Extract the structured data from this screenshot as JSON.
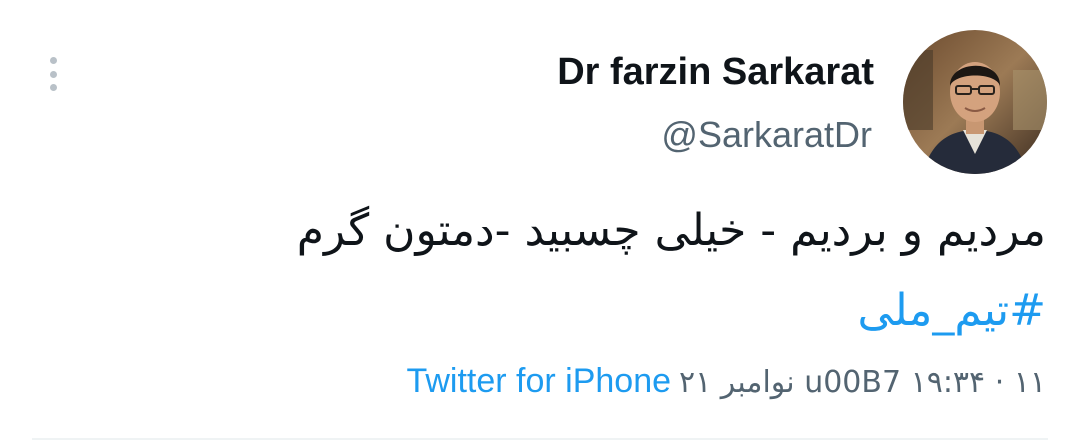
{
  "tweet": {
    "author": {
      "display_name": "Dr farzin Sarkarat",
      "handle": "@SarkaratDr",
      "avatar_icon": "profile-photo"
    },
    "text": "مردیم و بردیم - خیلی چسبید -دمتون گرم",
    "hashtag": "#تیم_ملی",
    "client": "Twitter for iPhone",
    "timestamp": "u00B7 ۱۹:۳۴ · ۱۱ نوامبر ۲۱",
    "more_icon": "more-vertical-icon"
  },
  "colors": {
    "link": "#1d9bf0",
    "secondary_text": "#536471",
    "primary_text": "#0f1419",
    "divider": "#eff3f4"
  }
}
